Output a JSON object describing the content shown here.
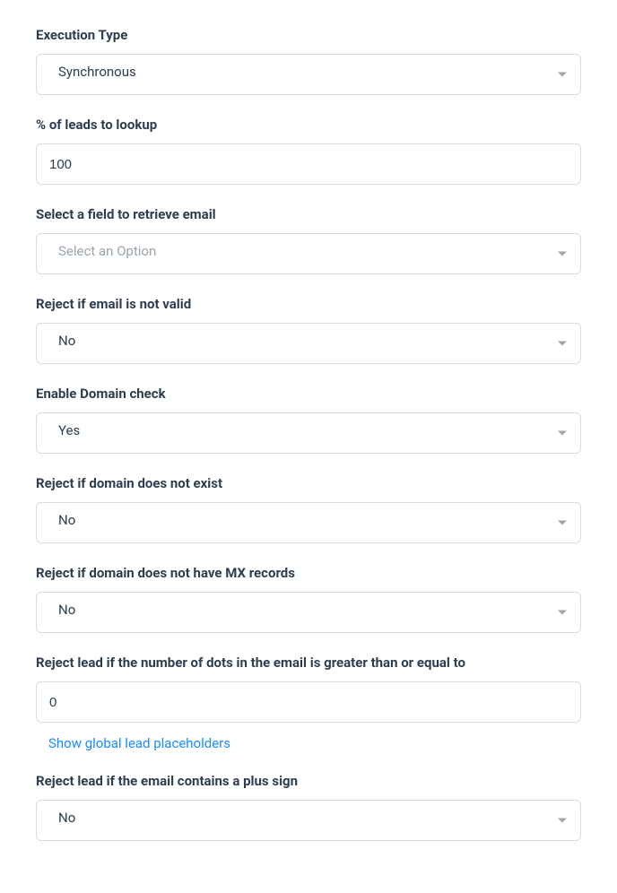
{
  "fields": {
    "executionType": {
      "label": "Execution Type",
      "value": "Synchronous"
    },
    "percentLeads": {
      "label": "% of leads to lookup",
      "value": "100"
    },
    "retrieveField": {
      "label": "Select a field to retrieve email",
      "value": "Select an Option"
    },
    "rejectInvalidEmail": {
      "label": "Reject if email is not valid",
      "value": "No"
    },
    "enableDomainCheck": {
      "label": "Enable Domain check",
      "value": "Yes"
    },
    "rejectDomainNotExist": {
      "label": "Reject if domain does not exist",
      "value": "No"
    },
    "rejectNoMx": {
      "label": "Reject if domain does not have MX records",
      "value": "No"
    },
    "rejectDotsCount": {
      "label": "Reject lead if the number of dots in the email is greater than or equal to",
      "value": "0"
    },
    "rejectPlusSign": {
      "label": "Reject lead if the email contains a plus sign",
      "value": "No"
    }
  },
  "links": {
    "showPlaceholders": "Show global lead placeholders"
  }
}
